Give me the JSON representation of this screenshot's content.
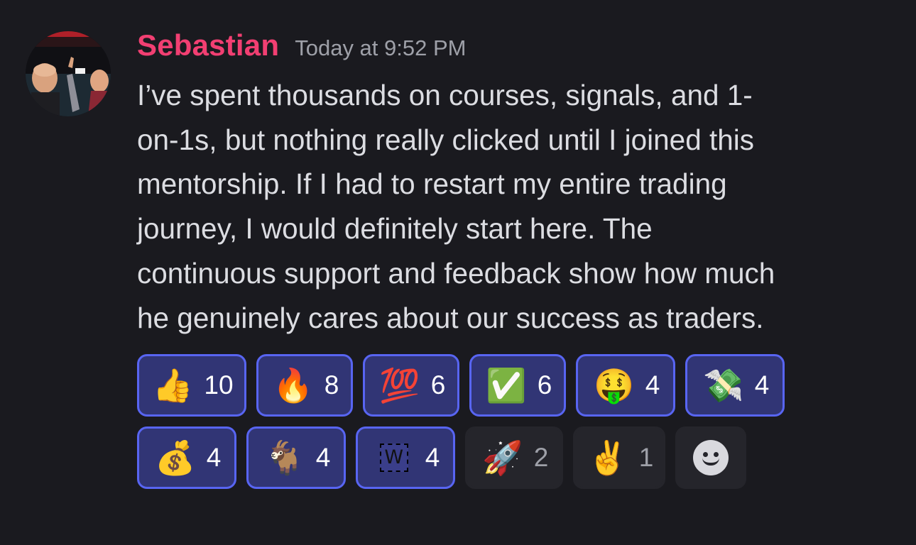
{
  "message": {
    "username": "Sebastian",
    "timestamp": "Today at 9:52 PM",
    "lines": [
      "I’ve spent thousands on courses, signals, and 1-",
      "on-1s, but nothing really clicked until I joined this",
      "mentorship. If I had to restart my entire trading",
      "journey, I would definitely start here. The",
      "continuous support and feedback show how much",
      "he genuinely cares about our success as traders."
    ]
  },
  "reactions": [
    {
      "emoji": "👍",
      "icon": "thumbs-up-icon",
      "count": "10",
      "me": true
    },
    {
      "emoji": "🔥",
      "icon": "fire-icon",
      "count": "8",
      "me": true
    },
    {
      "emoji": "💯",
      "icon": "hundred-points-icon",
      "count": "6",
      "me": true
    },
    {
      "emoji": "✅",
      "icon": "check-mark-button-icon",
      "count": "6",
      "me": true
    },
    {
      "emoji": "🤑",
      "icon": "money-mouth-face-icon",
      "count": "4",
      "me": true
    },
    {
      "emoji": "💸",
      "icon": "money-with-wings-icon",
      "count": "4",
      "me": true
    },
    {
      "emoji": "💰",
      "icon": "money-bag-icon",
      "count": "4",
      "me": true
    },
    {
      "emoji": "🐐",
      "icon": "goat-icon",
      "count": "4",
      "me": true
    },
    {
      "emoji": "W",
      "icon": "custom-w-emoji-icon",
      "count": "4",
      "me": true
    },
    {
      "emoji": "🚀",
      "icon": "rocket-icon",
      "count": "2",
      "me": false
    },
    {
      "emoji": "✌️",
      "icon": "victory-hand-icon",
      "count": "1",
      "me": false
    }
  ],
  "colors": {
    "background": "#1a1a1f",
    "username": "#f23f72",
    "timestamp": "#9ea0a8",
    "text": "#dcdde2",
    "reaction_me_bg": "#313575",
    "reaction_me_border": "#5865f2",
    "reaction_other_bg": "#25252b"
  }
}
